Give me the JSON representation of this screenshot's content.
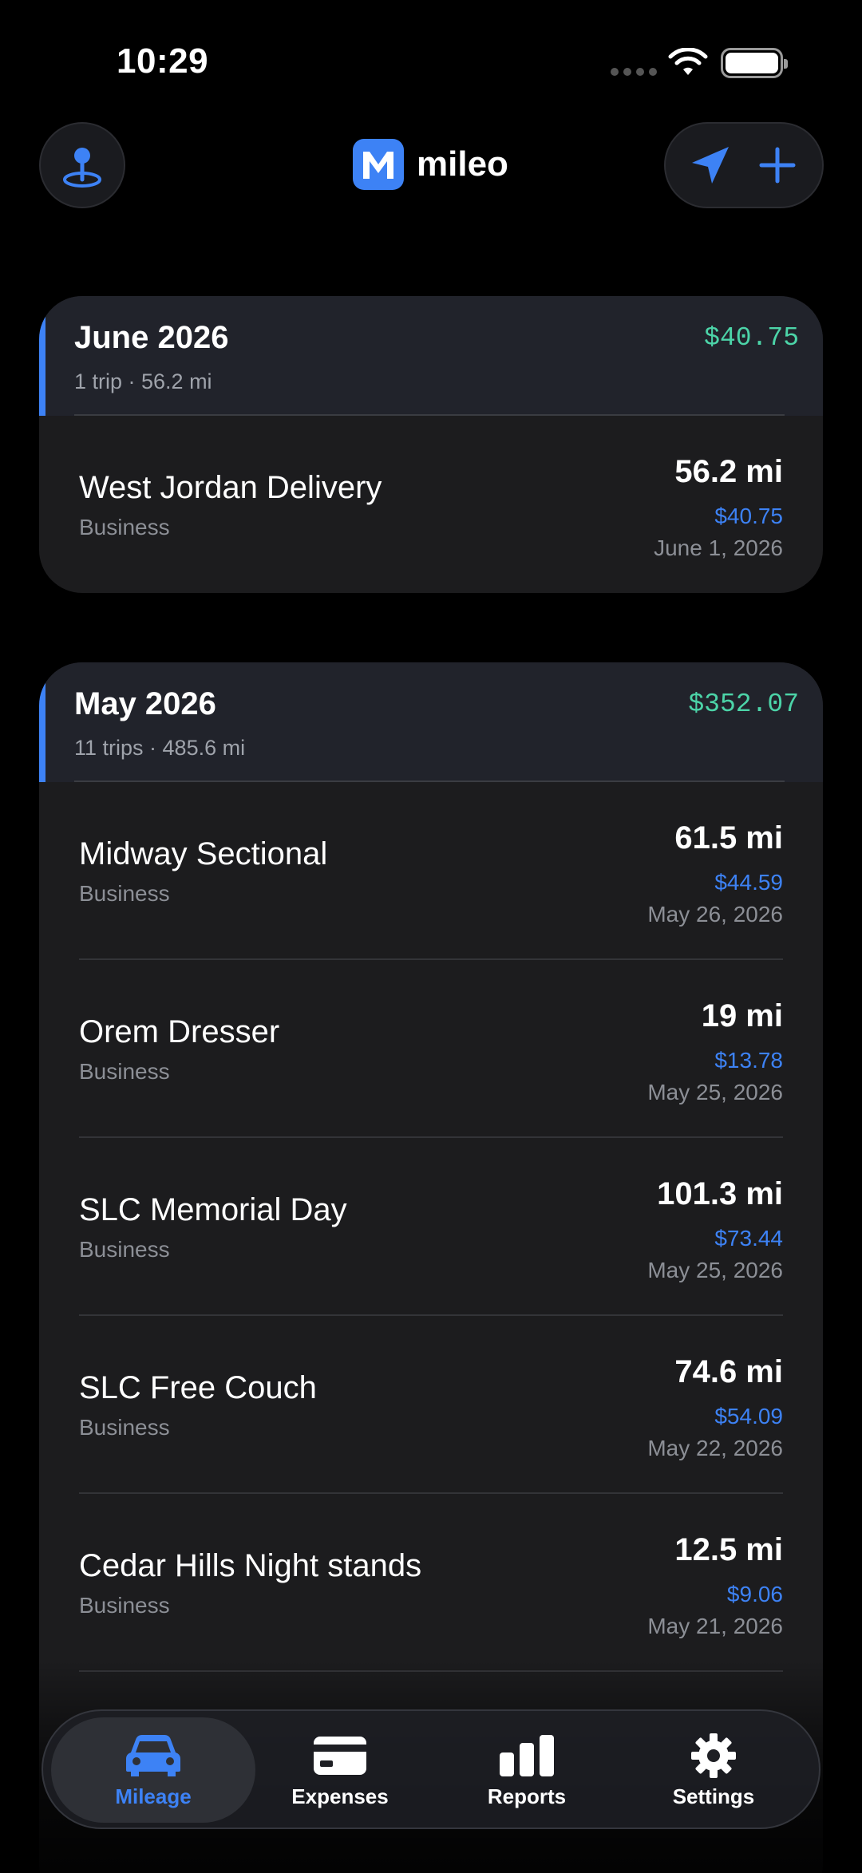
{
  "status": {
    "time": "10:29"
  },
  "header": {
    "app_name": "mileo"
  },
  "months": [
    {
      "title": "June 2026",
      "summary": "1 trip · 56.2 mi",
      "total": "$40.75",
      "trips": [
        {
          "name": "West Jordan Delivery",
          "category": "Business",
          "miles": "56.2 mi",
          "amount": "$40.75",
          "date": "June 1, 2026"
        }
      ]
    },
    {
      "title": "May 2026",
      "summary": "11 trips · 485.6 mi",
      "total": "$352.07",
      "trips": [
        {
          "name": "Midway Sectional",
          "category": "Business",
          "miles": "61.5 mi",
          "amount": "$44.59",
          "date": "May 26, 2026"
        },
        {
          "name": "Orem Dresser",
          "category": "Business",
          "miles": "19 mi",
          "amount": "$13.78",
          "date": "May 25, 2026"
        },
        {
          "name": "SLC Memorial Day",
          "category": "Business",
          "miles": "101.3 mi",
          "amount": "$73.44",
          "date": "May 25, 2026"
        },
        {
          "name": "SLC Free Couch",
          "category": "Business",
          "miles": "74.6 mi",
          "amount": "$54.09",
          "date": "May 22, 2026"
        },
        {
          "name": "Cedar Hills Night stands",
          "category": "Business",
          "miles": "12.5 mi",
          "amount": "$9.06",
          "date": "May 21, 2026"
        }
      ]
    }
  ],
  "tabs": [
    {
      "label": "Mileage",
      "icon": "car-icon",
      "active": true
    },
    {
      "label": "Expenses",
      "icon": "card-icon",
      "active": false
    },
    {
      "label": "Reports",
      "icon": "bar-chart-icon",
      "active": false
    },
    {
      "label": "Settings",
      "icon": "gear-icon",
      "active": false
    }
  ],
  "colors": {
    "accent": "#3d82f5",
    "money_total": "#4cd4a8",
    "background": "#000000"
  }
}
